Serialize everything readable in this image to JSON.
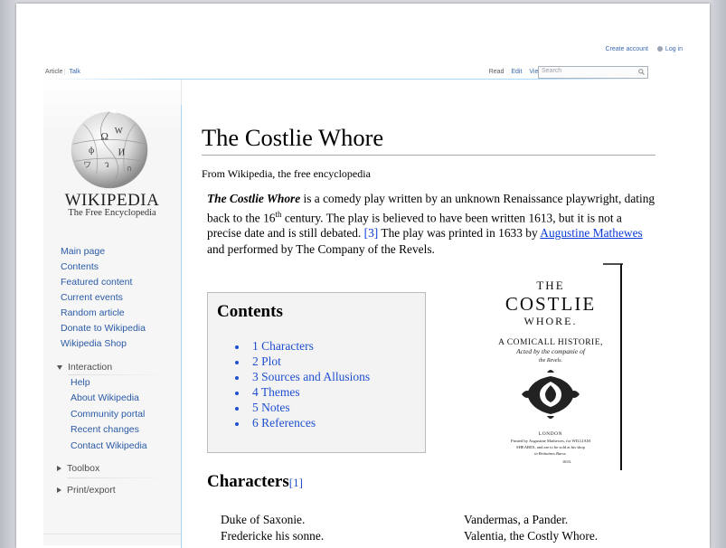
{
  "personal": {
    "create_account": "Create account",
    "login": "Log in"
  },
  "tabs": {
    "article": "Article",
    "talk": "Talk",
    "read": "Read",
    "edit": "Edit",
    "view_history": "View history"
  },
  "search": {
    "placeholder": "Search"
  },
  "logo": {
    "wordmark": "WIKIPEDIA",
    "tagline": "The Free Encyclopedia"
  },
  "sidebar": {
    "nav": [
      "Main page",
      "Contents",
      "Featured content",
      "Current events",
      "Random article",
      "Donate to Wikipedia",
      "Wikipedia Shop"
    ],
    "interaction_label": "Interaction",
    "interaction": [
      "Help",
      "About Wikipedia",
      "Community portal",
      "Recent changes",
      "Contact Wikipedia"
    ],
    "toolbox_label": "Toolbox",
    "printexport_label": "Print/export"
  },
  "article": {
    "title": "The Costlie Whore",
    "tagline": "From Wikipedia, the free encyclopedia",
    "lead_title": "The Costlie Whore",
    "lead_1": " is a comedy play written by an unknown Renaissance playwright, dating back to the 16",
    "lead_sup": "th",
    "lead_2": " century. The play is believed to have been written 1613, but it is not a precise date and is still debated. ",
    "ref3": "[3]",
    "lead_3": " The play was printed in 1633 by ",
    "link_mathewes": "Augustine Mathewes",
    "lead_4": " and performed by The Company of the Revels."
  },
  "toc": {
    "title": "Contents",
    "items": [
      "1 Characters",
      "2 Plot",
      "3 Sources and Allusions",
      "4 Themes",
      "5 Notes",
      "6 References"
    ]
  },
  "figure": {
    "line1": "THE",
    "line2": "COSTLIE",
    "line3": "WHORE.",
    "line4": "A COMICALL HISTORIE,",
    "line5": "Acted by the companie of",
    "line6": "the Revels.",
    "line7": "LONDON",
    "line8": "Printed by Augustine Mathewes, for WILLIAM",
    "line9": "SHEARES, and are to be sold at his shop",
    "line10": "in Brittaines Burse.",
    "line11": "1633."
  },
  "characters": {
    "heading": "Characters",
    "ref": "[1]",
    "left": [
      "Duke of Saxonie.",
      "Fredericke his sonne."
    ],
    "right": [
      "Vandermas, a Pander.",
      "Valentia, the Costly Whore."
    ]
  },
  "colors": {
    "link": "#1f4fd0",
    "toc_bg": "#f3f3f3",
    "sidebar_bg": "#f6f6f6"
  }
}
